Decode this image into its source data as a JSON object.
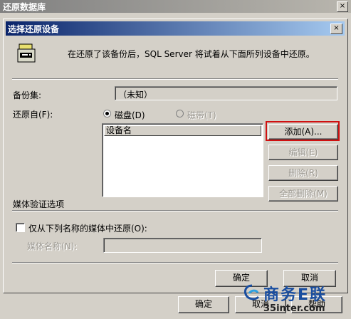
{
  "outer_window": {
    "title": "还原数据库",
    "close_glyph": "×",
    "ok_label": "确定",
    "cancel_label": "取消",
    "help_label": "帮助"
  },
  "dialog": {
    "title": "选择还原设备",
    "close_glyph": "×",
    "info_text": "在还原了该备份后，SQL Server 将试着从下面所列设备中还原。",
    "backup_set_label": "备份集:",
    "backup_set_value": "（未知）",
    "restore_from_label": "还原自(F):",
    "radio_disk_label": "磁盘(D)",
    "radio_tape_label": "磁带(T)",
    "selected_source": "磁盘",
    "device_list_header": "设备名",
    "device_list_items": [],
    "buttons": {
      "add": "添加(A)...",
      "edit": "编辑(E)",
      "remove": "删除(R)",
      "remove_all": "全部删除(M)",
      "ok": "确定",
      "cancel": "取消"
    },
    "media_section_label": "媒体验证选项",
    "media_checkbox_label": "仅从下列名称的媒体中还原(O):",
    "media_checkbox_checked": false,
    "media_name_label": "媒体名称(N):",
    "media_name_value": ""
  },
  "watermark": {
    "brand": "商务E联",
    "site": "35inter.com"
  },
  "colors": {
    "dialog_title_start": "#0a246a",
    "dialog_title_end": "#a6caf0",
    "face": "#d4d0c8",
    "highlight_border": "#d01010"
  }
}
